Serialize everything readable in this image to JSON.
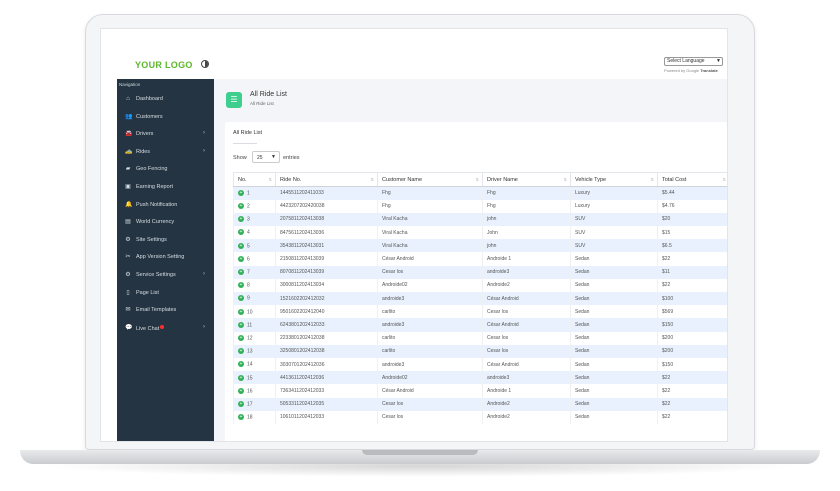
{
  "header": {
    "logo": "YOUR LOGO",
    "language_select": "Select Language",
    "powered_by": "Powered by",
    "powered_brand": "Google",
    "powered_translate": "Translate"
  },
  "sidebar": {
    "heading": "Navigation",
    "items": [
      {
        "label": "Dashboard",
        "icon": "home-icon",
        "glyph": "⌂",
        "arrow": ""
      },
      {
        "label": "Customers",
        "icon": "users-icon",
        "glyph": "👥",
        "arrow": ""
      },
      {
        "label": "Drivers",
        "icon": "car-icon",
        "glyph": "🚘",
        "arrow": "›"
      },
      {
        "label": "Rides",
        "icon": "ride-icon",
        "glyph": "🚕",
        "arrow": "›"
      },
      {
        "label": "Geo Fencing",
        "icon": "map-icon",
        "glyph": "▰",
        "arrow": ""
      },
      {
        "label": "Earning Report",
        "icon": "report-icon",
        "glyph": "▣",
        "arrow": ""
      },
      {
        "label": "Push Notification",
        "icon": "bell-icon",
        "glyph": "🔔",
        "arrow": ""
      },
      {
        "label": "World Currency",
        "icon": "money-icon",
        "glyph": "▤",
        "arrow": ""
      },
      {
        "label": "Site Settings",
        "icon": "cogs-icon",
        "glyph": "⚙",
        "arrow": ""
      },
      {
        "label": "App Version Setting",
        "icon": "tools-icon",
        "glyph": "✂",
        "arrow": ""
      },
      {
        "label": "Service Settings",
        "icon": "gear-icon",
        "glyph": "⚙",
        "arrow": "›"
      },
      {
        "label": "Page List",
        "icon": "page-icon",
        "glyph": "▯",
        "arrow": ""
      },
      {
        "label": "Email Templates",
        "icon": "envelope-icon",
        "glyph": "✉",
        "arrow": ""
      },
      {
        "label": "Live Chat",
        "icon": "chat-icon",
        "glyph": "💬",
        "arrow": "›",
        "badge": true
      }
    ]
  },
  "page": {
    "title": "All Ride List",
    "subtitle": "All Ride List",
    "card_title": "All Ride List",
    "show_label": "Show",
    "entries_value": "25",
    "entries_label": "entries"
  },
  "table": {
    "columns": [
      "No.",
      "Ride No.",
      "Customer Name",
      "Driver Name",
      "Vehicle Type",
      "Total Cost"
    ],
    "rows": [
      [
        "1",
        "1445511202411033",
        "Fhg",
        "Fhg",
        "Luxury",
        "$5.44"
      ],
      [
        "2",
        "4423207202420038",
        "Fhg",
        "Fhg",
        "Luxury",
        "$4.76"
      ],
      [
        "3",
        "2075811202413038",
        "Viral Kacha",
        "john",
        "SUV",
        "$20"
      ],
      [
        "4",
        "8475611202413036",
        "Viral Kacha",
        "John",
        "SUV",
        "$15"
      ],
      [
        "5",
        "3543811202413031",
        "Viral Kacha",
        "john",
        "SUV",
        "$6.5"
      ],
      [
        "6",
        "2150811202413039",
        "César Android",
        "Androide 1",
        "Sedan",
        "$22"
      ],
      [
        "7",
        "8070811202413039",
        "Cesar los",
        "androide3",
        "Sedan",
        "$11"
      ],
      [
        "8",
        "3000811202413034",
        "Androide02",
        "Androide2",
        "Sedan",
        "$22"
      ],
      [
        "9",
        "1521602202412032",
        "androide3",
        "César Android",
        "Sedan",
        "$100"
      ],
      [
        "10",
        "9501602202412040",
        "carlito",
        "Cesar los",
        "Sedan",
        "$569"
      ],
      [
        "11",
        "6243801202412033",
        "androide3",
        "César Android",
        "Sedan",
        "$150"
      ],
      [
        "12",
        "2233801202412038",
        "carlito",
        "Cesar los",
        "Sedan",
        "$200"
      ],
      [
        "13",
        "3250801202412038",
        "carlito",
        "Cesar los",
        "Sedan",
        "$200"
      ],
      [
        "14",
        "3030701202412036",
        "androide3",
        "César Android",
        "Sedan",
        "$150"
      ],
      [
        "15",
        "4413611202412036",
        "Androide02",
        "androide3",
        "Sedan",
        "$22"
      ],
      [
        "16",
        "7363411202412033",
        "César Android",
        "Androide 1",
        "Sedan",
        "$22"
      ],
      [
        "17",
        "5053311202412035",
        "Cesar los",
        "Androide2",
        "Sedan",
        "$22"
      ],
      [
        "18",
        "1061011202412033",
        "Cesar los",
        "Androide2",
        "Sedan",
        "$22"
      ]
    ]
  },
  "colors": {
    "logo": "#5cb72c",
    "sidebar": "#243442",
    "accent": "#3ecf8e",
    "row_stripe": "#e8f1fd",
    "expand_button": "#31b057",
    "badge": "#ff2d2d"
  }
}
